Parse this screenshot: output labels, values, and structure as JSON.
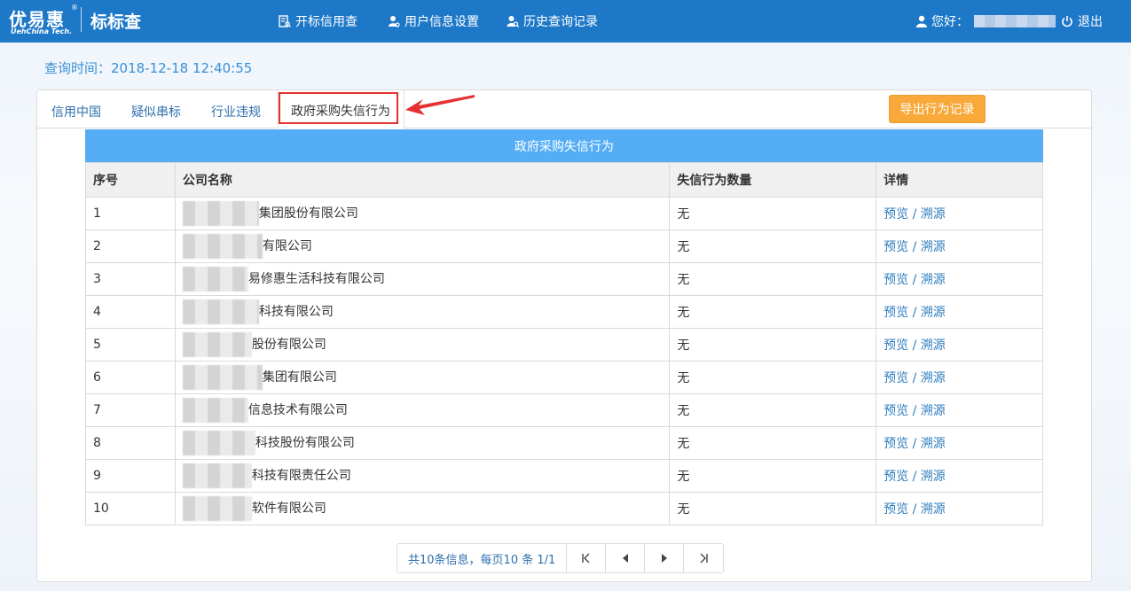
{
  "header": {
    "logo_text": "优易惠",
    "logo_sub": "UehChina Tech.",
    "logo_reg": "®",
    "app_title": "标标查",
    "nav": [
      {
        "label": "开标信用查",
        "icon": "document-search-icon"
      },
      {
        "label": "用户信息设置",
        "icon": "user-settings-icon"
      },
      {
        "label": "历史查询记录",
        "icon": "user-search-icon"
      }
    ],
    "greeting": "您好：",
    "logout_label": "退出"
  },
  "query_time": "查询时间：2018-12-18 12:40:55",
  "tabs": [
    {
      "label": "信用中国"
    },
    {
      "label": "疑似串标"
    },
    {
      "label": "行业违规"
    },
    {
      "label": "政府采购失信行为",
      "active": true
    }
  ],
  "export_label": "导出行为记录",
  "table": {
    "caption": "政府采购失信行为",
    "headers": [
      "序号",
      "公司名称",
      "失信行为数量",
      "详情"
    ],
    "rows": [
      {
        "no": "1",
        "name": "集团股份有限公司",
        "count": "无"
      },
      {
        "no": "2",
        "name": "有限公司",
        "count": "无"
      },
      {
        "no": "3",
        "name": "易修惠生活科技有限公司",
        "count": "无"
      },
      {
        "no": "4",
        "name": "科技有限公司",
        "count": "无"
      },
      {
        "no": "5",
        "name": "股份有限公司",
        "count": "无"
      },
      {
        "no": "6",
        "name": "集团有限公司",
        "count": "无"
      },
      {
        "no": "7",
        "name": "信息技术有限公司",
        "count": "无"
      },
      {
        "no": "8",
        "name": "科技股份有限公司",
        "count": "无"
      },
      {
        "no": "9",
        "name": "科技有限责任公司",
        "count": "无"
      },
      {
        "no": "10",
        "name": "软件有限公司",
        "count": "无"
      }
    ],
    "preview_label": "预览",
    "trace_label": "溯源",
    "link_sep": " / "
  },
  "pager": {
    "info": "共10条信息，每页10 条 1/1",
    "first_icon": "first-page-icon",
    "prev_icon": "prev-page-icon",
    "next_icon": "next-page-icon",
    "last_icon": "last-page-icon"
  }
}
